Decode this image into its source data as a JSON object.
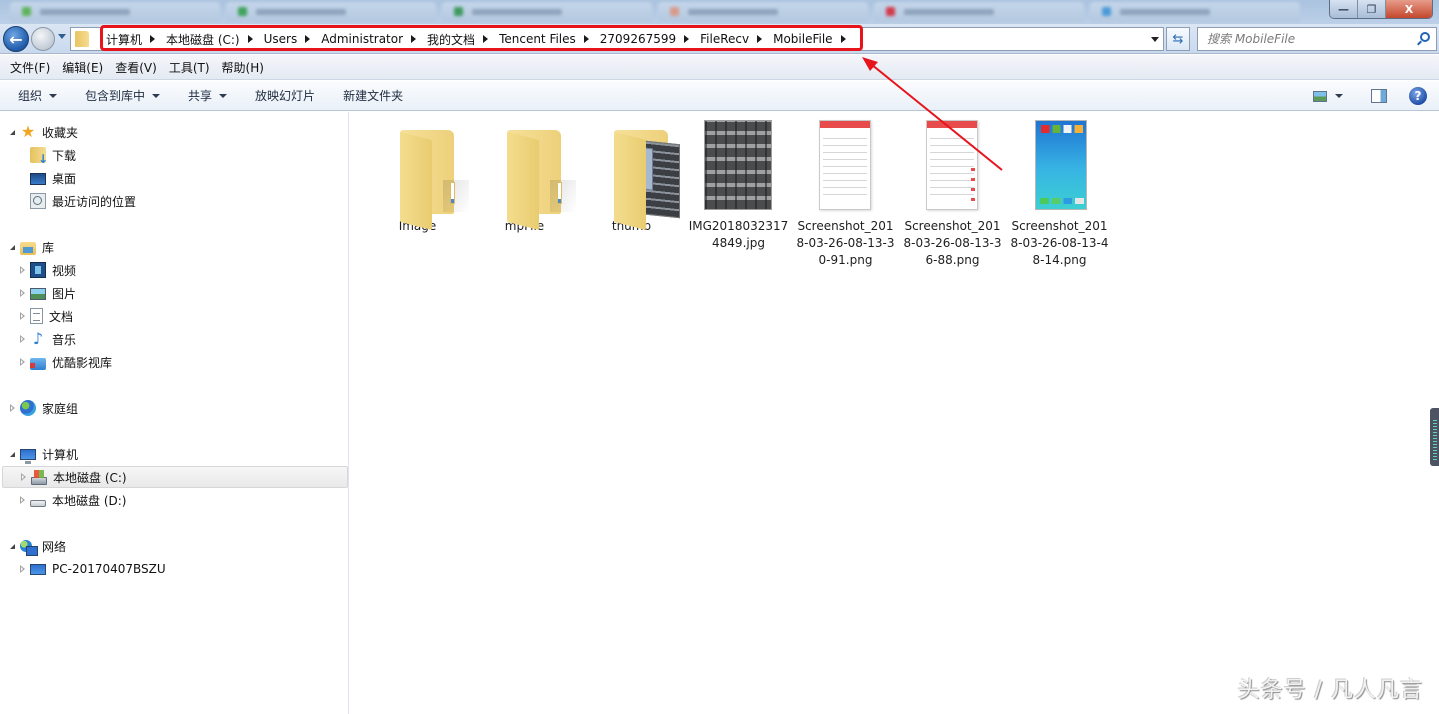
{
  "window": {
    "controls": {
      "minimize": "—",
      "restore": "❐",
      "close": "X"
    }
  },
  "navigation": {
    "back_icon": "←",
    "breadcrumbs": [
      {
        "label": "计算机"
      },
      {
        "label": "本地磁盘 (C:)"
      },
      {
        "label": "Users"
      },
      {
        "label": "Administrator"
      },
      {
        "label": "我的文档"
      },
      {
        "label": "Tencent Files"
      },
      {
        "label": "2709267599"
      },
      {
        "label": "FileRecv"
      },
      {
        "label": "MobileFile"
      }
    ],
    "refresh_icon": "⇆",
    "search_placeholder": "搜索 MobileFile"
  },
  "menubar": {
    "items": [
      "文件(F)",
      "编辑(E)",
      "查看(V)",
      "工具(T)",
      "帮助(H)"
    ]
  },
  "commandbar": {
    "organize": "组织",
    "include_in_library": "包含到库中",
    "share": "共享",
    "slideshow": "放映幻灯片",
    "new_folder": "新建文件夹",
    "help_icon": "?"
  },
  "navpane": {
    "favorites": {
      "label": "收藏夹",
      "items": [
        "下载",
        "桌面",
        "最近访问的位置"
      ]
    },
    "libraries": {
      "label": "库",
      "items": [
        "视频",
        "图片",
        "文档",
        "音乐",
        "优酷影视库"
      ]
    },
    "homegroup": {
      "label": "家庭组"
    },
    "computer": {
      "label": "计算机",
      "items": [
        "本地磁盘 (C:)",
        "本地磁盘 (D:)"
      ],
      "selected": "本地磁盘 (C:)"
    },
    "network": {
      "label": "网络",
      "items": [
        "PC-20170407BSZU"
      ]
    }
  },
  "files": [
    {
      "name": "Image",
      "type": "folder"
    },
    {
      "name": "mpFile",
      "type": "folder"
    },
    {
      "name": "thumb",
      "type": "folder"
    },
    {
      "name": "IMG20180323174849.jpg",
      "type": "jpg"
    },
    {
      "name": "Screenshot_2018-03-26-08-13-30-91.png",
      "type": "png"
    },
    {
      "name": "Screenshot_2018-03-26-08-13-36-88.png",
      "type": "png"
    },
    {
      "name": "Screenshot_2018-03-26-08-13-48-14.png",
      "type": "png"
    }
  ],
  "annotation": {
    "color": "#e8141b"
  },
  "watermark": "头条号 / 凡人凡言"
}
